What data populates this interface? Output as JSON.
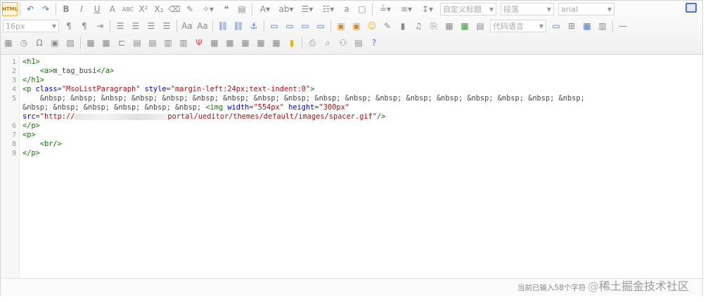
{
  "toolbar": {
    "html_button": "HTML",
    "font_size": "16px",
    "custom_title": "自定义标题",
    "paragraph": "段落",
    "font_family": "arial",
    "code_language": "代码语言"
  },
  "code": {
    "line_numbers": [
      "1",
      "2",
      "3",
      "4",
      "5",
      "",
      "",
      "6",
      "7",
      "8",
      "9"
    ],
    "l1": "<h1>",
    "l2_tag_open": "<a>",
    "l2_text": "m_tag_busi",
    "l2_tag_close": "</a>",
    "l3": "</h1>",
    "l4_open": "<p ",
    "l4_attr1": "class",
    "l4_val1": "\"MsoListParagraph\"",
    "l4_attr2": "style",
    "l4_val2": "\"margin-left:24px;text-indent:0\"",
    "l4_close": ">",
    "l5_part1": "&nbsp; &nbsp; &nbsp; &nbsp; &nbsp; &nbsp; &nbsp; &nbsp; &nbsp; &nbsp; &nbsp; &nbsp; &nbsp; &nbsp; &nbsp; &nbsp; &nbsp; &nbsp;",
    "l5_part2": "&nbsp; &nbsp; &nbsp; &nbsp; &nbsp; &nbsp; ",
    "img_open": "<img ",
    "img_attr_w": "width",
    "img_val_w": "\"554px\"",
    "img_attr_h": "height",
    "img_val_h": "\"300px\"",
    "img_attr_src": "src",
    "img_src_start": "\"http://",
    "img_src_end": "portal/ueditor/themes/default/images/spacer.gif\"",
    "img_close": "/>",
    "l6": "</p>",
    "l7": "<p>",
    "l8": "<br/>",
    "l9": "</p>"
  },
  "status": {
    "text": "当前已输入58个字符"
  },
  "watermark": {
    "text": "稀土掘金技术社区"
  }
}
